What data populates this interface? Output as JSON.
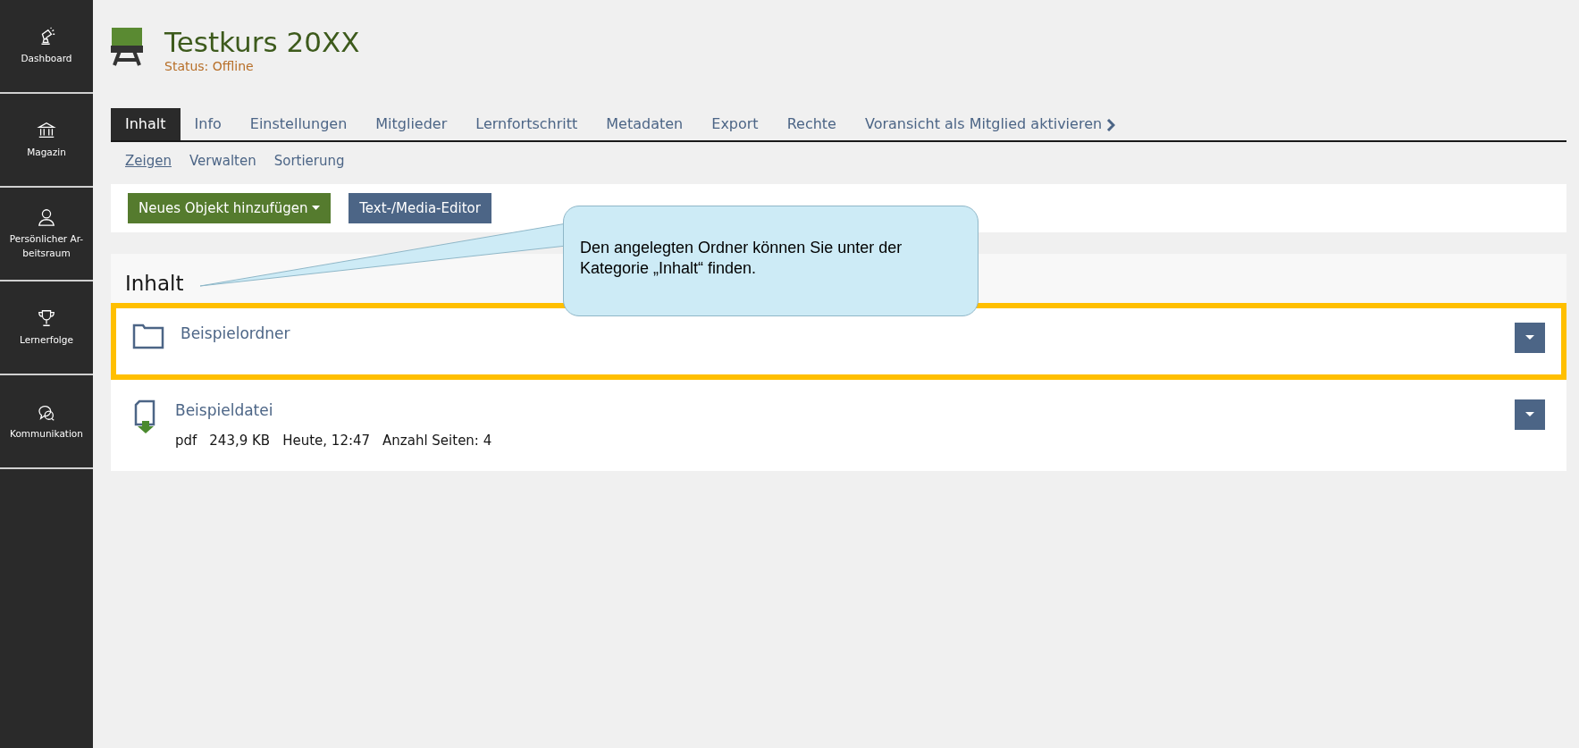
{
  "sidebar": {
    "items": [
      {
        "label": "Dashboard"
      },
      {
        "label": "Magazin"
      },
      {
        "label": "Persönlicher Ar-beitsraum"
      },
      {
        "label": "Lernerfolge"
      },
      {
        "label": "Kommunikation"
      }
    ]
  },
  "header": {
    "title": "Testkurs 20XX",
    "status": "Status: Offline"
  },
  "tabs": [
    {
      "label": "Inhalt",
      "selected": true
    },
    {
      "label": "Info",
      "selected": false
    },
    {
      "label": "Einstellungen",
      "selected": false
    },
    {
      "label": "Mitglieder",
      "selected": false
    },
    {
      "label": "Lernfortschritt",
      "selected": false
    },
    {
      "label": "Metadaten",
      "selected": false
    },
    {
      "label": "Export",
      "selected": false
    },
    {
      "label": "Rechte",
      "selected": false
    },
    {
      "label": "Voransicht als Mitglied aktivieren",
      "selected": false,
      "kind": "action"
    }
  ],
  "subtabs": [
    {
      "label": "Zeigen",
      "selected": true
    },
    {
      "label": "Verwalten",
      "selected": false
    },
    {
      "label": "Sortierung",
      "selected": false
    }
  ],
  "toolbar": {
    "buttons": [
      {
        "label": "Neues Objekt hinzufügen",
        "kind": "dropdown"
      },
      {
        "label": "Text-/Media-Editor",
        "kind": "plain"
      }
    ]
  },
  "content": {
    "title": "Inhalt",
    "items": [
      {
        "kind": "folder",
        "title": "Beispielordner",
        "highlighted": true
      },
      {
        "kind": "file",
        "title": "Beispieldatei",
        "highlighted": false,
        "properties": [
          "pdf",
          "243,9 KB",
          "Heute, 12:47",
          "Anzahl Seiten: 4"
        ]
      }
    ]
  },
  "callout": {
    "text": "Den angelegten Ordner können Sie unter der Kategorie „Inhalt“ finden."
  }
}
